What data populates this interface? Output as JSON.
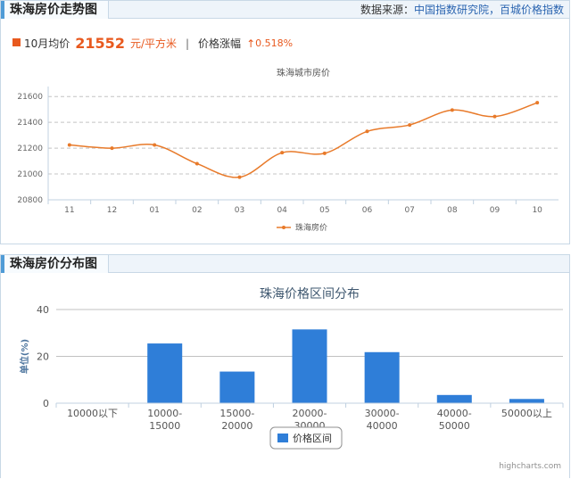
{
  "trend_panel": {
    "tab_title": "珠海房价走势图",
    "source_label": "数据来源：",
    "source_links": "中国指数研究院，百城价格指数",
    "stat_month_label": "10月均价",
    "stat_value": "21552",
    "stat_unit": "元/平方米",
    "stat_separator": "|",
    "stat_change_label": "价格涨幅",
    "stat_change_arrow": "↑",
    "stat_change_value": "0.518%"
  },
  "dist_panel": {
    "tab_title": "珠海房价分布图",
    "watermark": "highcharts.com"
  },
  "colors": {
    "line": "#e87a2a",
    "bar": "#2f7ed8",
    "accent": "#e8591e",
    "tab_bar": "#4f9bd6"
  },
  "chart_data": [
    {
      "type": "line",
      "title": "珠海城市房价",
      "categories": [
        "11",
        "12",
        "01",
        "02",
        "03",
        "04",
        "05",
        "06",
        "07",
        "08",
        "09",
        "10"
      ],
      "series": [
        {
          "name": "珠海房价",
          "values": [
            21225,
            21200,
            21225,
            21080,
            20975,
            21165,
            21160,
            21330,
            21380,
            21495,
            21445,
            21552
          ]
        }
      ],
      "yticks": [
        20800,
        21000,
        21200,
        21400,
        21600
      ],
      "ylim": [
        20800,
        21650
      ],
      "grid": true,
      "legend": "bottom-center"
    },
    {
      "type": "bar",
      "title": "珠海价格区间分布",
      "categories": [
        "10000以下",
        "10000-\n15000",
        "15000-\n20000",
        "20000-\n30000",
        "30000-\n40000",
        "40000-\n50000",
        "50000以上"
      ],
      "series": [
        {
          "name": "价格区间",
          "values": [
            0,
            25.5,
            13.5,
            31.5,
            21.8,
            3.5,
            1.8
          ]
        }
      ],
      "ylabel": "单位(%)",
      "yticks": [
        0,
        20,
        40
      ],
      "ylim": [
        0,
        40
      ],
      "grid": true,
      "legend": "bottom-center"
    }
  ]
}
